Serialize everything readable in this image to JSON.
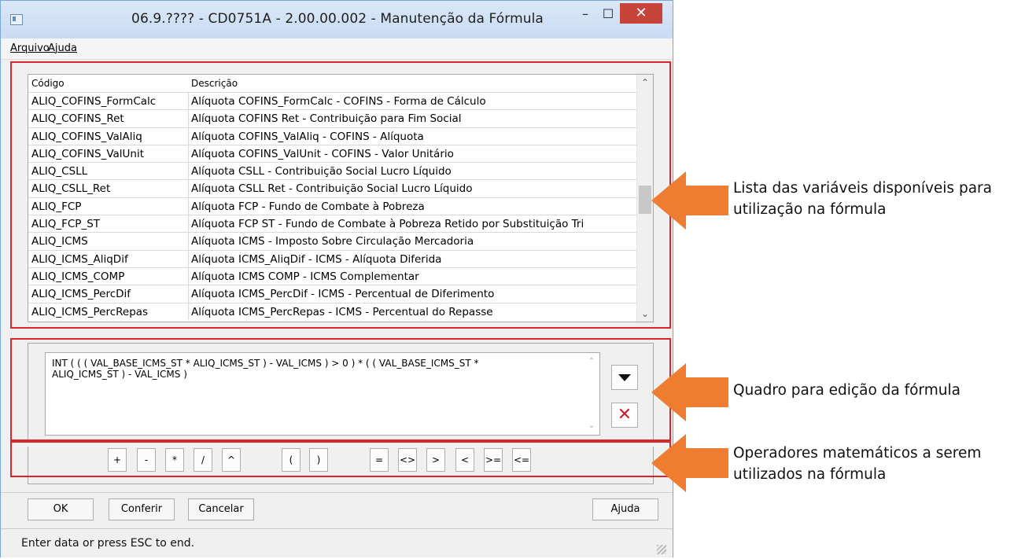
{
  "window": {
    "title": "06.9.???? - CD0751A - 2.00.00.002 - Manutenção da Fórmula",
    "minimize_glyph": "–",
    "maximize_glyph": "☐",
    "close_glyph": "✕"
  },
  "menu": {
    "items": [
      "Arquivo",
      "Ajuda"
    ]
  },
  "variables": {
    "headers": {
      "code": "Código",
      "description": "Descrição"
    },
    "rows": [
      {
        "code": "ALIQ_COFINS_FormCalc",
        "description": "Alíquota COFINS_FormCalc - COFINS - Forma de Cálculo"
      },
      {
        "code": "ALIQ_COFINS_Ret",
        "description": "Alíquota COFINS Ret - Contribuição para Fim Social"
      },
      {
        "code": "ALIQ_COFINS_ValAliq",
        "description": "Alíquota COFINS_ValAliq - COFINS - Alíquota"
      },
      {
        "code": "ALIQ_COFINS_ValUnit",
        "description": "Alíquota COFINS_ValUnit - COFINS - Valor Unitário"
      },
      {
        "code": "ALIQ_CSLL",
        "description": "Alíquota CSLL - Contribuição Social Lucro Líquido"
      },
      {
        "code": "ALIQ_CSLL_Ret",
        "description": "Alíquota CSLL Ret - Contribuição Social Lucro Líquido"
      },
      {
        "code": "ALIQ_FCP",
        "description": "Alíquota FCP - Fundo de Combate à Pobreza"
      },
      {
        "code": "ALIQ_FCP_ST",
        "description": "Alíquota FCP ST - Fundo de Combate à Pobreza Retido por Substituição Tri"
      },
      {
        "code": "ALIQ_ICMS",
        "description": "Alíquota ICMS - Imposto Sobre Circulação Mercadoria"
      },
      {
        "code": "ALIQ_ICMS_AliqDif",
        "description": "Alíquota ICMS_AliqDif - ICMS - Alíquota Diferida"
      },
      {
        "code": "ALIQ_ICMS_COMP",
        "description": "Alíquota ICMS COMP - ICMS Complementar"
      },
      {
        "code": "ALIQ_ICMS_PercDif",
        "description": "Alíquota ICMS_PercDif - ICMS - Percentual de Diferimento"
      },
      {
        "code": "ALIQ_ICMS_PercRepas",
        "description": "Alíquota ICMS_PercRepas - ICMS - Percentual do Repasse"
      }
    ]
  },
  "formula": {
    "line1": "INT ( ( ( VAL_BASE_ICMS_ST * ALIQ_ICMS_ST ) - VAL_ICMS ) > 0 ) * ( ( VAL_BASE_ICMS_ST *",
    "line2": "ALIQ_ICMS_ST ) - VAL_ICMS )"
  },
  "operators": [
    "+",
    "-",
    "*",
    "/",
    "^",
    "(",
    ")",
    "=",
    "<>",
    ">",
    "<",
    ">=",
    "<="
  ],
  "buttons": {
    "ok": "OK",
    "conferir": "Conferir",
    "cancelar": "Cancelar",
    "ajuda": "Ajuda"
  },
  "status": {
    "text": "Enter data or press ESC to end."
  },
  "annotations": {
    "list": [
      "Lista das variáveis disponíveis para",
      "utilização na fórmula"
    ],
    "editor": [
      "Quadro para edição da fórmula"
    ],
    "operators": [
      "Operadores matemáticos a serem",
      "utilizados na fórmula"
    ]
  },
  "colors": {
    "highlight_red": "#d6262c",
    "arrow_orange": "#ee7d31",
    "close_red": "#c7443a"
  }
}
